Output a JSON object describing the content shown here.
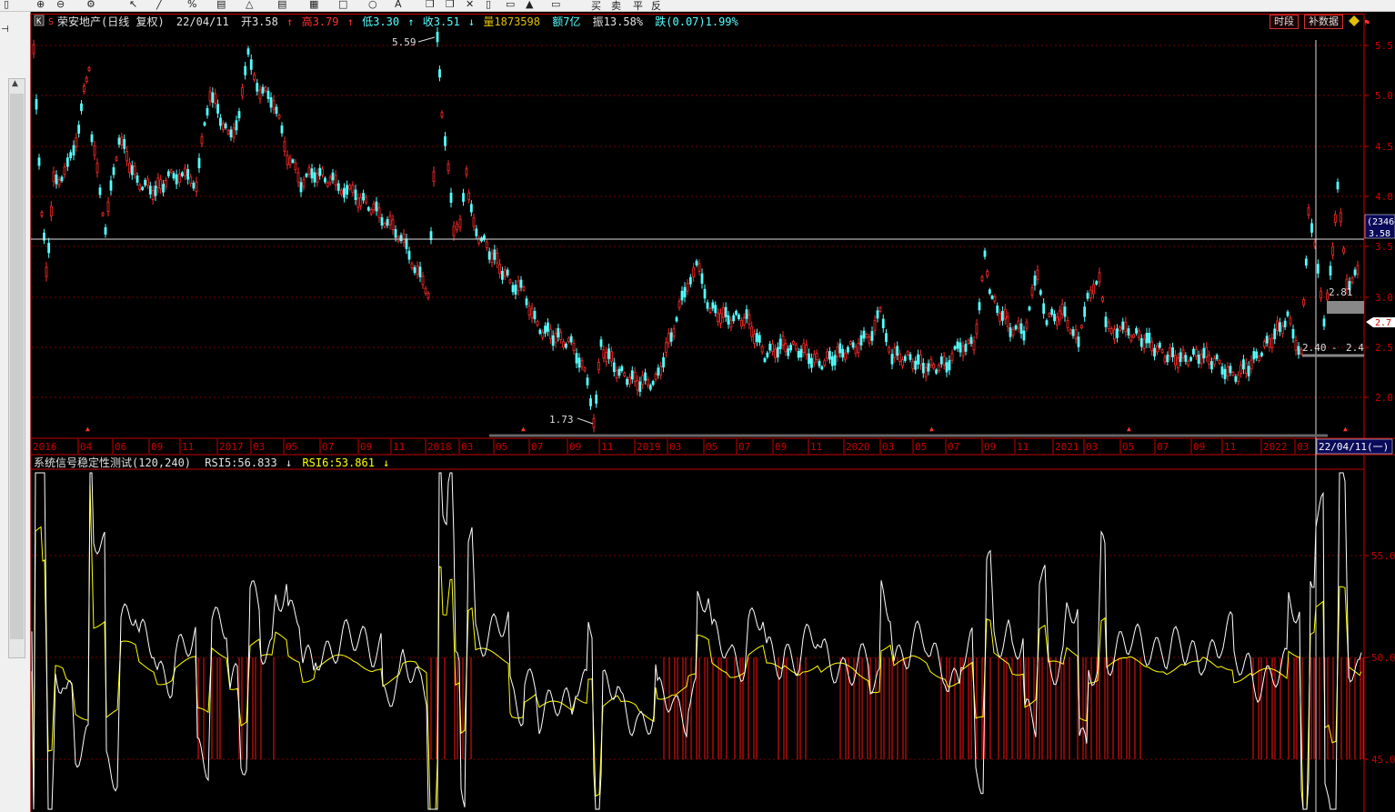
{
  "toolbar": {
    "icons": [
      "pan-icon",
      "zoom-in-icon",
      "zoom-out-icon",
      "settings-icon",
      "pointer-icon",
      "line-tool-icon",
      "percent-icon",
      "ruler-icon",
      "triangle-icon",
      "doc-icon",
      "grid-icon",
      "box-icon",
      "circle-icon",
      "text-icon",
      "copy-icon",
      "paste-icon",
      "close-icon",
      "trash-icon",
      "lock-icon",
      "save-icon",
      "buy-icon",
      "sell-icon",
      "flat-icon",
      "ban-icon"
    ],
    "labels": {
      "text_tool": "A",
      "buy": "买",
      "sell": "卖",
      "flat": "平",
      "ban": "反"
    }
  },
  "header": {
    "k_badge": "K",
    "s_badge": "S",
    "name": "荣安地产(日线 复权)",
    "date": "22/04/11",
    "open": "开3.58",
    "high": "高3.79",
    "low": "低3.30",
    "close": "收3.51",
    "volume": "量1873598",
    "amount": "额7亿",
    "amplitude": "振13.58%",
    "change": "跌(0.07)1.99%",
    "btn_period": "时段",
    "btn_fill": "补数据"
  },
  "price_axis": {
    "ticks": [
      "5.5",
      "5.0",
      "4.5",
      "4.0",
      "3.5",
      "3.0",
      "2.5",
      "2.0"
    ],
    "marker_code": "(2346",
    "marker_price": "3.58",
    "right_price": "2.7"
  },
  "annotations": {
    "high_label": "5.59",
    "low_label": "1.73",
    "level_a": "2.81",
    "level_b": "2.40",
    "level_b2": "2.4"
  },
  "date_axis": {
    "labels": [
      "2016",
      "04",
      "06",
      "09",
      "11",
      "2017",
      "03",
      "05",
      "07",
      "09",
      "11",
      "2018",
      "03",
      "05",
      "07",
      "09",
      "11",
      "2019",
      "03",
      "05",
      "07",
      "09",
      "11",
      "2020",
      "03",
      "05",
      "07",
      "09",
      "11",
      "2021",
      "03",
      "05",
      "07",
      "09",
      "11",
      "2022",
      "03"
    ],
    "current": "22/04/11(一)"
  },
  "indicator": {
    "title": "系统信号稳定性测试(120,240)",
    "rsi5": "RSI5:56.833",
    "rsi6": "RSI6:53.861",
    "ticks": [
      "55.0",
      "50.0",
      "45.0"
    ]
  },
  "colors": {
    "up": "#ff2a2a",
    "down": "#54ffff",
    "rsi5": "#ffffff",
    "rsi6": "#ffff00",
    "axis": "#c80000",
    "grid": "#7a0000"
  }
}
